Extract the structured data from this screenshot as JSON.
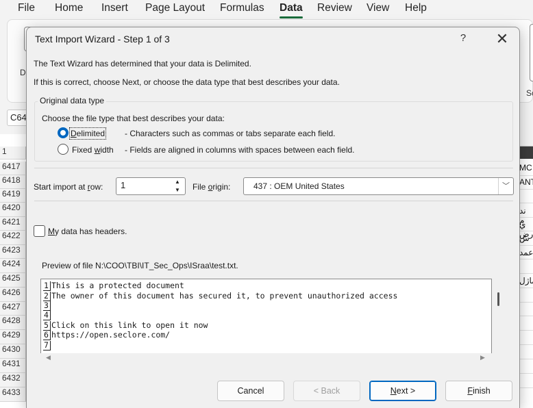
{
  "menu": {
    "tabs": [
      "File",
      "Home",
      "Insert",
      "Page Layout",
      "Formulas",
      "Data",
      "Review",
      "View",
      "Help"
    ],
    "active": "Data"
  },
  "background": {
    "name_box": "C64",
    "ribbon_fragments": {
      "left": "Da",
      "right": "Sc"
    },
    "column_header_row": "1",
    "rows": [
      "6417",
      "6418",
      "6419",
      "6420",
      "6421",
      "6422",
      "6423",
      "6424",
      "6425",
      "6426",
      "6427",
      "6428",
      "6429",
      "6430",
      "6431",
      "6432",
      "6433"
    ],
    "right_cells": [
      "MC",
      "ANT",
      "",
      "ند م",
      "ي رض",
      "ش",
      "عمد",
      "",
      "ماژل"
    ]
  },
  "dialog": {
    "title": "Text Import Wizard - Step 1 of 3",
    "help_label": "?",
    "close_label": "✕",
    "intro_line1": "The Text Wizard has determined that your data is Delimited.",
    "intro_line2": "If this is correct, choose Next, or choose the data type that best describes your data.",
    "group_title": "Original data type",
    "group_prompt": "Choose the file type that best describes your data:",
    "options": [
      {
        "label": "Delimited",
        "description": "- Characters such as commas or tabs separate each field.",
        "checked": true
      },
      {
        "label_pre": "Fixed ",
        "label_key": "w",
        "label_post": "idth",
        "description": "- Fields are aligned in columns with spaces between each field.",
        "checked": false
      }
    ],
    "start_row_label_pre": "Start import at ",
    "start_row_label_key": "r",
    "start_row_label_post": "ow:",
    "start_row_value": "1",
    "file_origin_label_pre": "File ",
    "file_origin_label_key": "o",
    "file_origin_label_post": "rigin:",
    "file_origin_value": "437 : OEM United States",
    "headers_label_key": "M",
    "headers_label_post": "y data has headers.",
    "headers_checked": false,
    "preview_label": "Preview of file N:\\COO\\TBI\\IT_Sec_Ops\\ISraa\\test.txt.",
    "preview_lines": [
      {
        "n": "1",
        "text": "This is a protected document"
      },
      {
        "n": "2",
        "text": "The owner of this document has secured it, to prevent unauthorized access"
      },
      {
        "n": "3",
        "text": ""
      },
      {
        "n": "4",
        "text": ""
      },
      {
        "n": "5",
        "text": "Click on this link to open it now"
      },
      {
        "n": "6",
        "text": "https://open.seclore.com/"
      },
      {
        "n": "7",
        "text": ""
      }
    ],
    "buttons": {
      "cancel": "Cancel",
      "back": "< Back",
      "next_key": "N",
      "next_post": "ext >",
      "finish_key": "F",
      "finish_post": "inish"
    }
  },
  "colors": {
    "accent": "#0067c0",
    "excel_green": "#1a6c3b"
  }
}
